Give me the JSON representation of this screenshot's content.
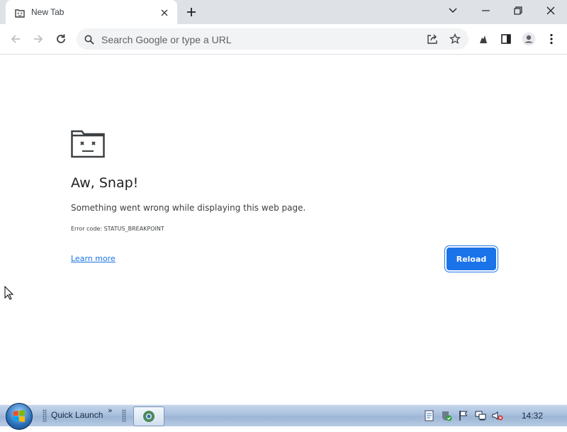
{
  "browser": {
    "tab": {
      "title": "New Tab"
    },
    "omnibox": {
      "placeholder": "Search Google or type a URL",
      "value": ""
    }
  },
  "error_page": {
    "title": "Aw, Snap!",
    "message": "Something went wrong while displaying this web page.",
    "error_code": "Error code: STATUS_BREAKPOINT",
    "learn_more": "Learn more",
    "reload": "Reload"
  },
  "taskbar": {
    "quick_launch_label": "Quick Launch",
    "overflow_chevron": "»",
    "clock": "14:32"
  },
  "icons": {
    "tab_favicon": "sad-tab-icon",
    "window_controls": [
      "tab-search-icon",
      "minimize-icon",
      "restore-icon",
      "close-icon"
    ],
    "toolbar": [
      "back-arrow-icon",
      "forward-arrow-icon",
      "reload-icon",
      "search-icon",
      "share-icon",
      "star-icon",
      "extensions-icon",
      "side-panel-icon",
      "profile-icon",
      "menu-icon"
    ],
    "tray": [
      "notes-icon",
      "security-shield-icon",
      "flag-icon",
      "network-icon",
      "volume-muted-icon"
    ]
  },
  "colors": {
    "accent": "#1a73e8",
    "tab_strip": "#dee1e6",
    "omnibox": "#f1f3f4"
  }
}
